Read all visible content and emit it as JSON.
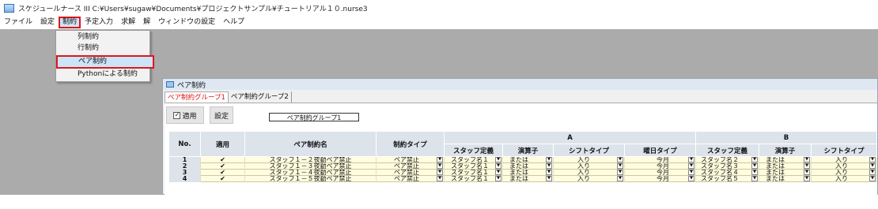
{
  "window": {
    "title": "スケジュールナース III  C:¥Users¥sugaw¥Documents¥プロジェクトサンプル¥チュートリアル１０.nurse3"
  },
  "menu": [
    "ファイル",
    "設定",
    "制約",
    "予定入力",
    "求解",
    "解",
    "ウィンドウの設定",
    "ヘルプ"
  ],
  "dropdown": {
    "items": [
      "列制約",
      "行制約",
      "ペア制約",
      "Pythonによる制約"
    ],
    "selected_index": 2
  },
  "child": {
    "title": "ペア制約",
    "tabs": [
      "ペア制約グループ1",
      "ペア制約グループ2"
    ],
    "apply_label": "適用",
    "apply_checked": true,
    "settings_button": "設定",
    "group_name": "ペア制約グループ1",
    "grid": {
      "headers": {
        "no": "No.",
        "apply": "適用",
        "name": "ペア制約名",
        "type": "制約タイプ",
        "a": "A",
        "b": "B",
        "a_staff": "スタッフ定義",
        "a_op": "演算子",
        "a_shift": "シフトタイプ",
        "a_day": "曜日タイプ",
        "b_staff": "スタッフ定義",
        "b_op": "演算子",
        "b_shift": "シフトタイプ"
      },
      "rows": [
        {
          "no": "1",
          "checked": "✔",
          "name": "スタッフ１－２夜勤ペア禁止",
          "type": "ペア禁止",
          "a_staff": "スタッフ名１",
          "a_op": "または",
          "a_shift": "入り",
          "a_day": "今月",
          "b_staff": "スタッフ名２",
          "b_op": "または",
          "b_shift": "入り"
        },
        {
          "no": "2",
          "checked": "✔",
          "name": "スタッフ１－３夜勤ペア禁止",
          "type": "ペア禁止",
          "a_staff": "スタッフ名１",
          "a_op": "または",
          "a_shift": "入り",
          "a_day": "今月",
          "b_staff": "スタッフ名３",
          "b_op": "または",
          "b_shift": "入り"
        },
        {
          "no": "3",
          "checked": "✔",
          "name": "スタッフ１－４夜勤ペア禁止",
          "type": "ペア禁止",
          "a_staff": "スタッフ名１",
          "a_op": "または",
          "a_shift": "入り",
          "a_day": "今月",
          "b_staff": "スタッフ名４",
          "b_op": "または",
          "b_shift": "入り"
        },
        {
          "no": "4",
          "checked": "✔",
          "name": "スタッフ１－５夜勤ペア禁止",
          "type": "ペア禁止",
          "a_staff": "スタッフ名１",
          "a_op": "または",
          "a_shift": "入り",
          "a_day": "今月",
          "b_staff": "スタッフ名５",
          "b_op": "または",
          "b_shift": "入り"
        }
      ]
    }
  },
  "colors": {
    "highlight": "#e0151b",
    "workspace": "#ababab",
    "header": "#dde3eb",
    "row": "#fffce0"
  }
}
